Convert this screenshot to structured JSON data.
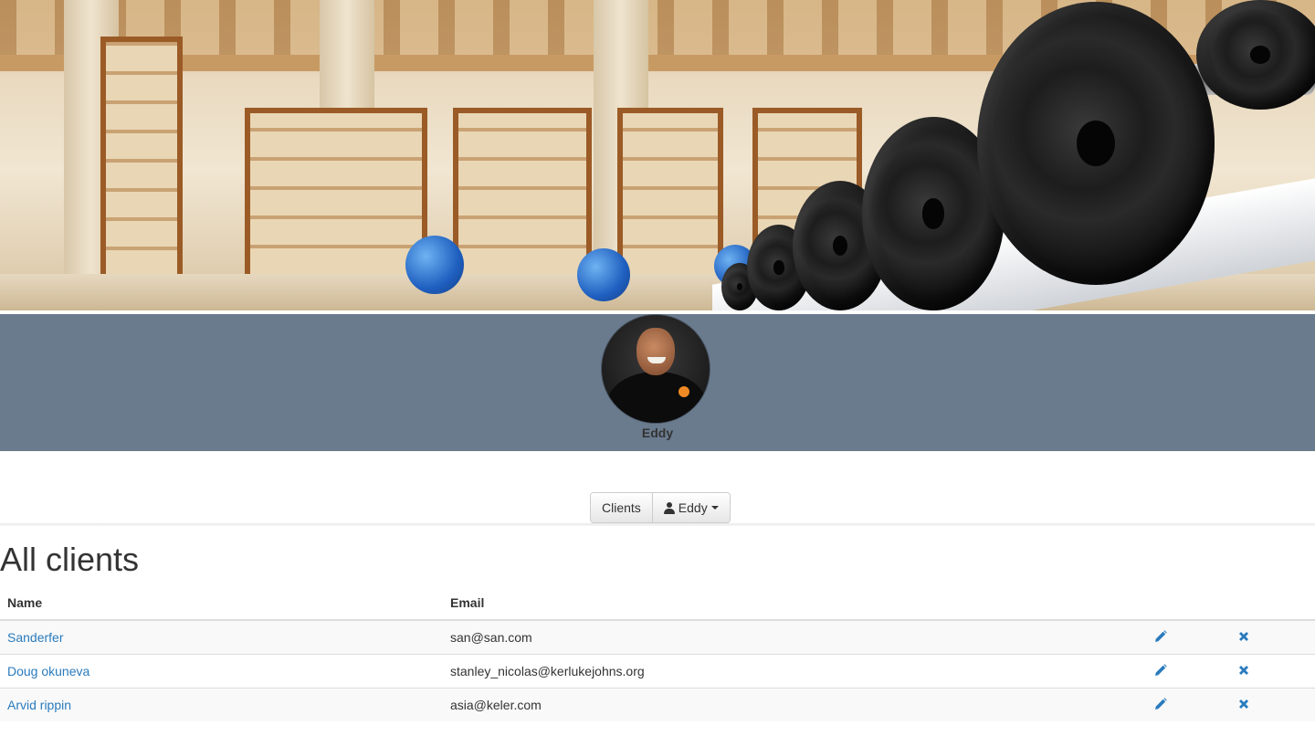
{
  "hero": {
    "image_icon": "gym-dumbbells-photo"
  },
  "profile": {
    "name": "Eddy",
    "avatar_icon": "trainer-avatar-photo",
    "band_color": "#6a7b8e"
  },
  "nav": {
    "clients_label": "Clients",
    "user_label": "Eddy",
    "user_icon": "user-icon",
    "caret_icon": "chevron-down-icon"
  },
  "page": {
    "title": "All clients"
  },
  "table": {
    "columns": [
      "Name",
      "Email"
    ],
    "rows": [
      {
        "name": "Sanderfer",
        "email": "san@san.com"
      },
      {
        "name": "Doug okuneva",
        "email": "stanley_nicolas@kerlukejohns.org"
      },
      {
        "name": "Arvid rippin",
        "email": "asia@keler.com"
      }
    ],
    "edit_icon": "pencil-icon",
    "delete_icon": "close-icon",
    "link_color": "#2a7bbd",
    "icon_color": "#2a7bbd"
  }
}
